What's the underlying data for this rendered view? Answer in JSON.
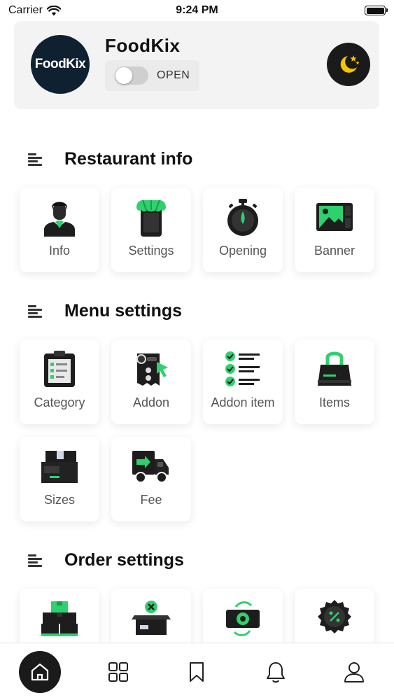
{
  "status_bar": {
    "carrier": "Carrier",
    "time": "9:24 PM"
  },
  "header": {
    "logo_text": "FoodKix",
    "shop_name": "FoodKix",
    "toggle_label": "OPEN",
    "toggle_on": false
  },
  "sections": {
    "restaurant": {
      "title": "Restaurant info",
      "tiles": [
        {
          "label": "Info",
          "icon": "person-icon"
        },
        {
          "label": "Settings",
          "icon": "shop-settings-icon"
        },
        {
          "label": "Opening",
          "icon": "stopwatch-icon"
        },
        {
          "label": "Banner",
          "icon": "image-banner-icon"
        }
      ]
    },
    "menu": {
      "title": "Menu settings",
      "tiles": [
        {
          "label": "Category",
          "icon": "clipboard-icon"
        },
        {
          "label": "Addon",
          "icon": "addon-icon"
        },
        {
          "label": "Addon item",
          "icon": "checklist-icon"
        },
        {
          "label": "Items",
          "icon": "shopping-bag-icon"
        },
        {
          "label": "Sizes",
          "icon": "box-icon"
        },
        {
          "label": "Fee",
          "icon": "delivery-truck-icon"
        }
      ]
    },
    "order": {
      "title": "Order settings",
      "tiles": [
        {
          "label": "",
          "icon": "stacked-boxes-icon"
        },
        {
          "label": "",
          "icon": "open-box-icon"
        },
        {
          "label": "",
          "icon": "cash-icon"
        },
        {
          "label": "",
          "icon": "discount-badge-icon"
        }
      ]
    }
  },
  "bottom_nav": [
    {
      "name": "home",
      "icon": "home-icon"
    },
    {
      "name": "grid",
      "icon": "grid-icon"
    },
    {
      "name": "bookmark",
      "icon": "bookmark-icon"
    },
    {
      "name": "notifications",
      "icon": "bell-icon"
    },
    {
      "name": "profile",
      "icon": "user-icon"
    }
  ],
  "colors": {
    "accent": "#2fd16e",
    "dark": "#1a1a1a",
    "moon": "#f5c400"
  }
}
